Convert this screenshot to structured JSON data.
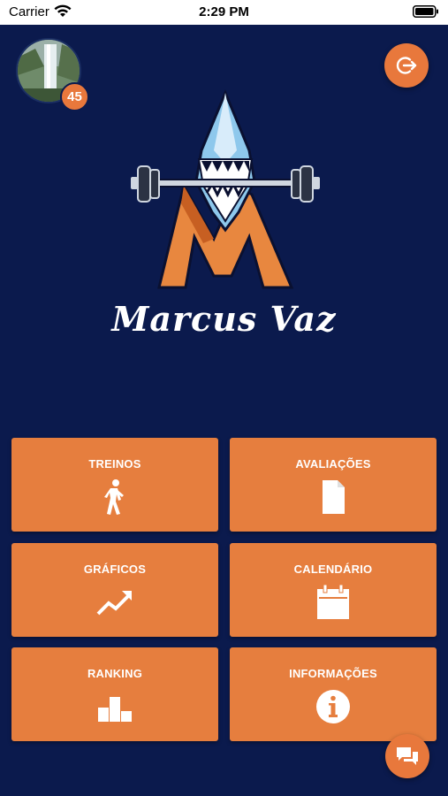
{
  "status_bar": {
    "carrier": "Carrier",
    "time": "2:29 PM"
  },
  "profile": {
    "badge_count": "45"
  },
  "brand": {
    "name": "Marcus Vaz"
  },
  "menu": {
    "tiles": [
      {
        "label": "TREINOS",
        "icon": "walking-person-icon"
      },
      {
        "label": "AVALIAÇÕES",
        "icon": "document-icon"
      },
      {
        "label": "GRÁFICOS",
        "icon": "trending-up-icon"
      },
      {
        "label": "CALENDÁRIO",
        "icon": "calendar-icon"
      },
      {
        "label": "RANKING",
        "icon": "podium-icon"
      },
      {
        "label": "INFORMAÇÕES",
        "icon": "info-icon"
      }
    ]
  },
  "colors": {
    "background": "#0b1a4d",
    "accent": "#e67e3e"
  }
}
